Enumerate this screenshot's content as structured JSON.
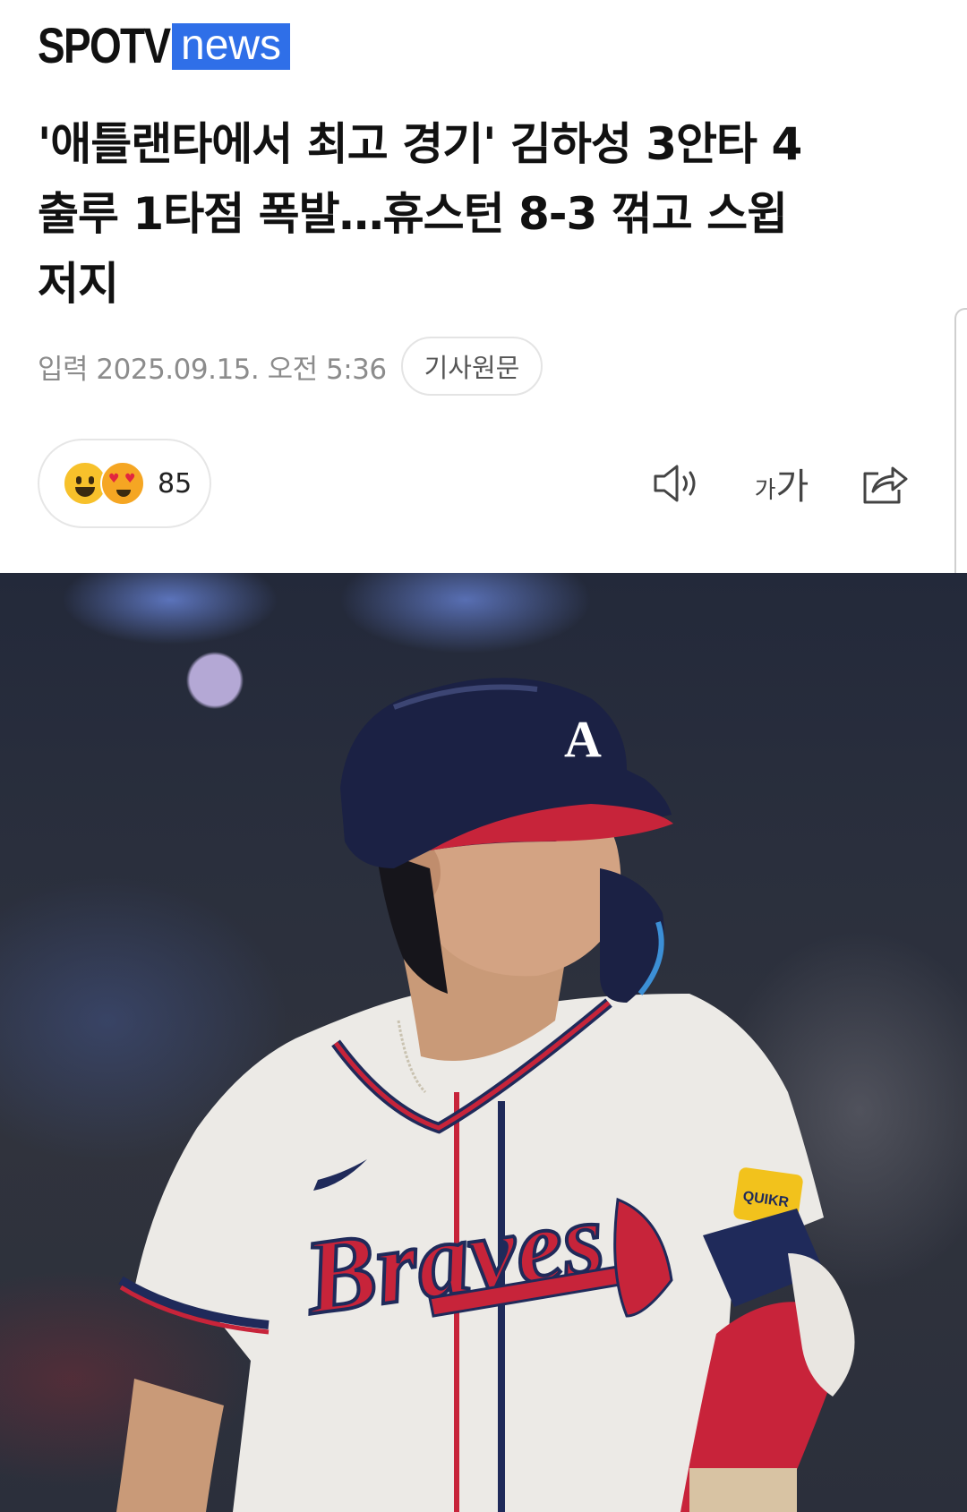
{
  "brand": {
    "name_part1": "SPOTV",
    "name_part2": "news",
    "accent_color": "#2f6fe8"
  },
  "article": {
    "headline_lines": [
      "'애틀랜타에서 최고 경기' 김하성 3안타 4",
      "출루 1타점 폭발…휴스턴 8-3 꺾고 스윕",
      "저지"
    ],
    "published": "입력 2025.09.15. 오전 5:36",
    "source_button": "기사원문"
  },
  "reactions": {
    "emojis": [
      "grinning-face-icon",
      "heart-eyes-face-icon"
    ],
    "count": "85"
  },
  "toolbar": {
    "speaker_icon": "speaker-icon",
    "font_small": "가",
    "font_large": "가",
    "share_icon": "share-icon"
  },
  "photo": {
    "jersey_text": "Braves",
    "helmet_letter": "A",
    "patch_text": "QUIKR"
  }
}
